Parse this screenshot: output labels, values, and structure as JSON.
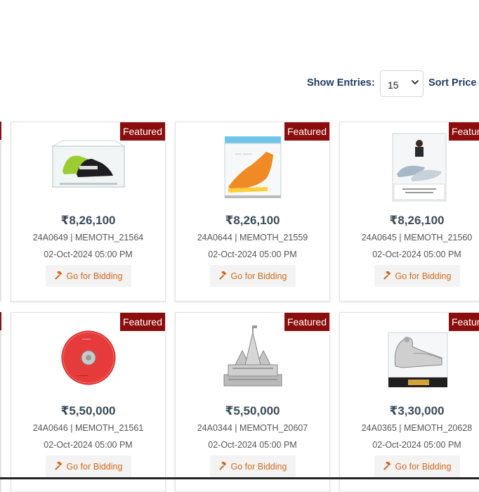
{
  "toolbar": {
    "show_entries_label": "Show Entries:",
    "entries_value": "15",
    "sort_label": "Sort Price"
  },
  "featured_label": "Featured",
  "bid_label": "Go for Bidding",
  "products": [
    {
      "price": "₹8,26,100",
      "lot": "24A0649 | MEMOTH_21564",
      "date": "02-Oct-2024 05:00 PM",
      "image": "shoes-in-display-case"
    },
    {
      "price": "₹8,26,100",
      "lot": "24A0644 | MEMOTH_21559",
      "date": "02-Oct-2024 05:00 PM",
      "image": "orange-shoe-in-display-case"
    },
    {
      "price": "₹8,26,100",
      "lot": "24A0645 | MEMOTH_21560",
      "date": "02-Oct-2024 05:00 PM",
      "image": "signed-shoes-display-case"
    },
    {
      "price": "₹5,50,000",
      "lot": "24A0646 | MEMOTH_21561",
      "date": "02-Oct-2024 05:00 PM",
      "image": "red-discus"
    },
    {
      "price": "₹5,50,000",
      "lot": "24A0344 | MEMOTH_20607",
      "date": "02-Oct-2024 05:00 PM",
      "image": "silver-temple-model"
    },
    {
      "price": "₹3,30,000",
      "lot": "24A0365 | MEMOTH_20628",
      "date": "02-Oct-2024 05:00 PM",
      "image": "silver-peacock-in-case"
    }
  ],
  "colors": {
    "featured_bg": "#8b0d0d",
    "label_blue": "#1f3a5f",
    "bid_orange": "#d2691e"
  }
}
